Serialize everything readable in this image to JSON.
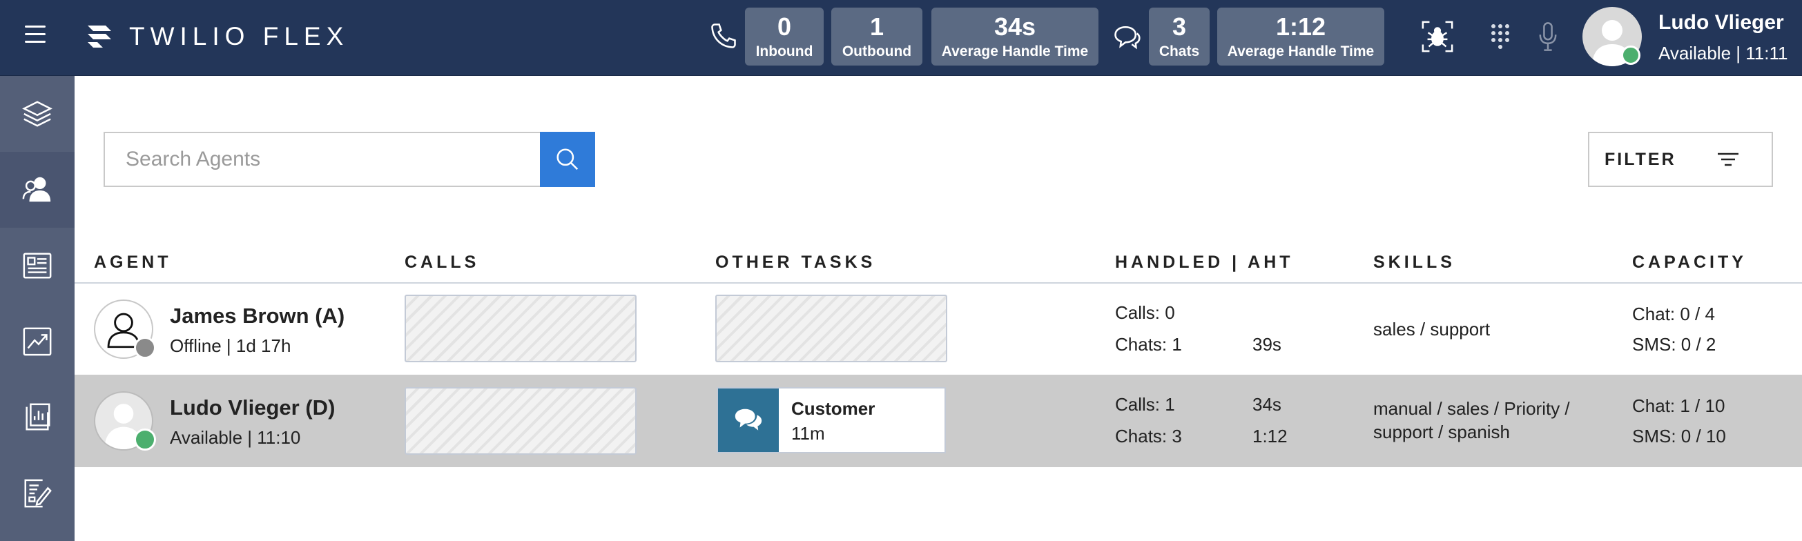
{
  "header": {
    "brand": "TWILIO FLEX",
    "voice_stats": [
      {
        "value": "0",
        "label": "Inbound"
      },
      {
        "value": "1",
        "label": "Outbound"
      },
      {
        "value": "34s",
        "label": "Average Handle Time"
      }
    ],
    "chat_stats": [
      {
        "value": "3",
        "label": "Chats"
      },
      {
        "value": "1:12",
        "label": "Average Handle Time"
      }
    ],
    "user": {
      "name": "Ludo Vlieger",
      "status": "Available | 11:11"
    }
  },
  "sidebar": {
    "items": [
      {
        "icon": "layers-icon"
      },
      {
        "icon": "agents-icon",
        "active": true
      },
      {
        "icon": "task-list-icon"
      },
      {
        "icon": "analytics-icon"
      },
      {
        "icon": "dashboard-icon"
      },
      {
        "icon": "edit-note-icon"
      }
    ]
  },
  "search": {
    "placeholder": "Search Agents"
  },
  "filter": {
    "label": "FILTER"
  },
  "table": {
    "columns": {
      "agent": "AGENT",
      "calls": "CALLS",
      "other_tasks": "OTHER TASKS",
      "handled": "HANDLED | AHT",
      "skills": "SKILLS",
      "capacity": "CAPACITY"
    },
    "rows": [
      {
        "name": "James Brown (A)",
        "status": "Offline | 1d 17h",
        "presence_color": "#8a8a8a",
        "handled_calls": "Calls: 0",
        "aht_calls": "",
        "handled_chats": "Chats: 1",
        "aht_chats": "39s",
        "skills": "sales / support",
        "capacity_chat": "Chat: 0 / 4",
        "capacity_sms": "SMS: 0 / 2"
      },
      {
        "name": "Ludo Vlieger (D)",
        "status": "Available | 11:10",
        "presence_color": "#4caf6e",
        "task": {
          "title": "Customer",
          "time": "11m"
        },
        "handled_calls": "Calls: 1",
        "aht_calls": "34s",
        "handled_chats": "Chats: 3",
        "aht_chats": "1:12",
        "skills_line1": "manual / sales / Priority /",
        "skills_line2": "support / spanish",
        "capacity_chat": "Chat: 1 / 10",
        "capacity_sms": "SMS: 0 / 10"
      }
    ]
  }
}
